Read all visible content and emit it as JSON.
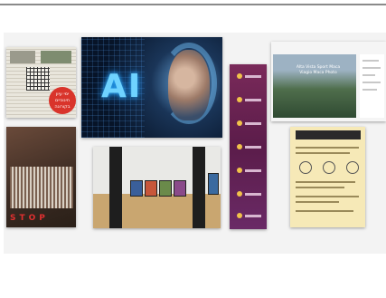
{
  "collage": {
    "ai_card": {
      "text": "AI"
    },
    "news_card": {
      "stamp_text": "ימי עיון חינוכיים בקורונה"
    },
    "landscape_card": {
      "title": "Alta Vista Sport Maca Viagio Maca Photo"
    },
    "circuit_card": {
      "text": "STOP"
    }
  },
  "colors": {
    "ai_glow": "#6fd3ff",
    "stamp_red": "#d9342b",
    "strip_purple": "#5b1c4a",
    "info_yellow": "#f6e9b7"
  }
}
